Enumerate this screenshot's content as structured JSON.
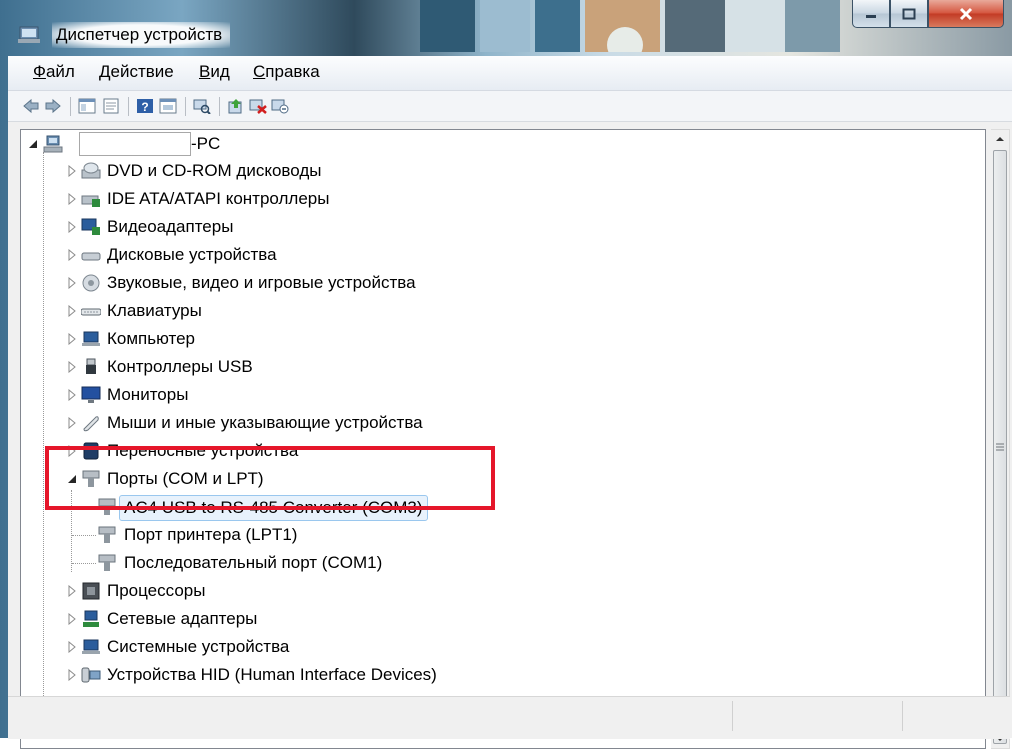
{
  "window": {
    "title": "Диспетчер устройств"
  },
  "menu": [
    "Файл",
    "Действие",
    "Вид",
    "Справка"
  ],
  "toolbar_icons": [
    "back-icon",
    "forward-icon",
    "show-hide-tree-icon",
    "properties-icon",
    "help-icon",
    "action-view-icon",
    "scan-hardware-icon",
    "update-driver-icon",
    "disable-device-icon",
    "uninstall-device-icon"
  ],
  "tree": {
    "root": "-PC",
    "items": [
      {
        "label": "DVD и CD-ROM дисководы",
        "icon": "dvd-drive-icon"
      },
      {
        "label": "IDE ATA/ATAPI контроллеры",
        "icon": "ide-controller-icon"
      },
      {
        "label": "Видеоадаптеры",
        "icon": "display-adapter-icon"
      },
      {
        "label": "Дисковые устройства",
        "icon": "disk-drive-icon"
      },
      {
        "label": "Звуковые, видео и игровые устройства",
        "icon": "sound-device-icon"
      },
      {
        "label": "Клавиатуры",
        "icon": "keyboard-icon"
      },
      {
        "label": "Компьютер",
        "icon": "computer-icon"
      },
      {
        "label": "Контроллеры USB",
        "icon": "usb-controller-icon"
      },
      {
        "label": "Мониторы",
        "icon": "monitor-icon"
      },
      {
        "label": "Мыши и иные указывающие устройства",
        "icon": "mouse-icon"
      },
      {
        "label": "Переносные устройства",
        "icon": "portable-device-icon"
      },
      {
        "label": "Порты (COM и LPT)",
        "icon": "port-icon"
      },
      {
        "label": "AC4 USB to RS-485 Converter (COM3)",
        "icon": "port-icon"
      },
      {
        "label": "Порт принтера (LPT1)",
        "icon": "port-icon"
      },
      {
        "label": "Последовательный порт (COM1)",
        "icon": "port-icon"
      },
      {
        "label": "Процессоры",
        "icon": "processor-icon"
      },
      {
        "label": "Сетевые адаптеры",
        "icon": "network-adapter-icon"
      },
      {
        "label": "Системные устройства",
        "icon": "system-device-icon"
      },
      {
        "label": "Устройства HID (Human Interface Devices)",
        "icon": "hid-device-icon"
      }
    ]
  },
  "colors": {
    "highlight": "#e5162a",
    "selection": "#e8f2fc"
  }
}
